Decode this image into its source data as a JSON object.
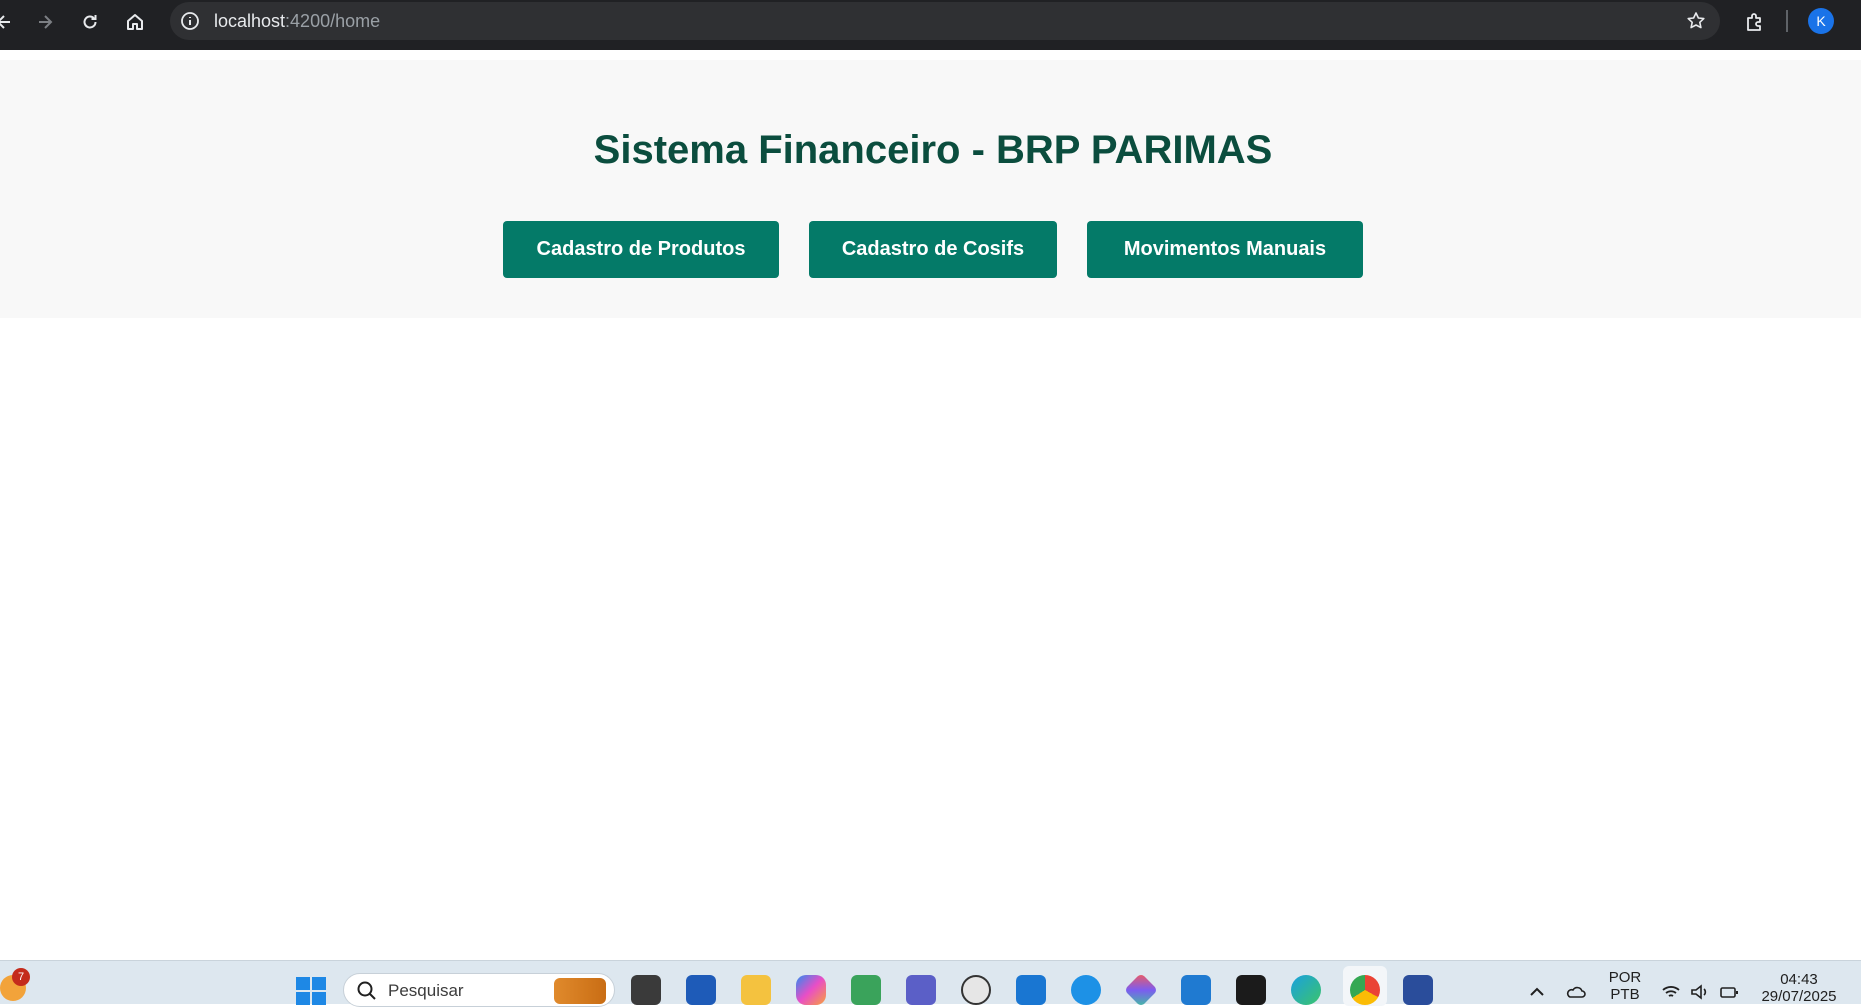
{
  "browser": {
    "url_host": "localhost",
    "url_path": ":4200/home",
    "profile_initial": "K"
  },
  "page": {
    "title": "Sistema Financeiro - BRP PARIMAS",
    "buttons": [
      {
        "label": "Cadastro de Produtos"
      },
      {
        "label": "Cadastro de Cosifs"
      },
      {
        "label": "Movimentos Manuais"
      }
    ]
  },
  "taskbar": {
    "notification_count": "7",
    "search_placeholder": "Pesquisar",
    "language_top": "POR",
    "language_bottom": "PTB",
    "time": "04:43",
    "date": "29/07/2025"
  },
  "colors": {
    "title": "#0b4d3e",
    "button": "#047a68",
    "header_bg": "#f8f8f8"
  }
}
